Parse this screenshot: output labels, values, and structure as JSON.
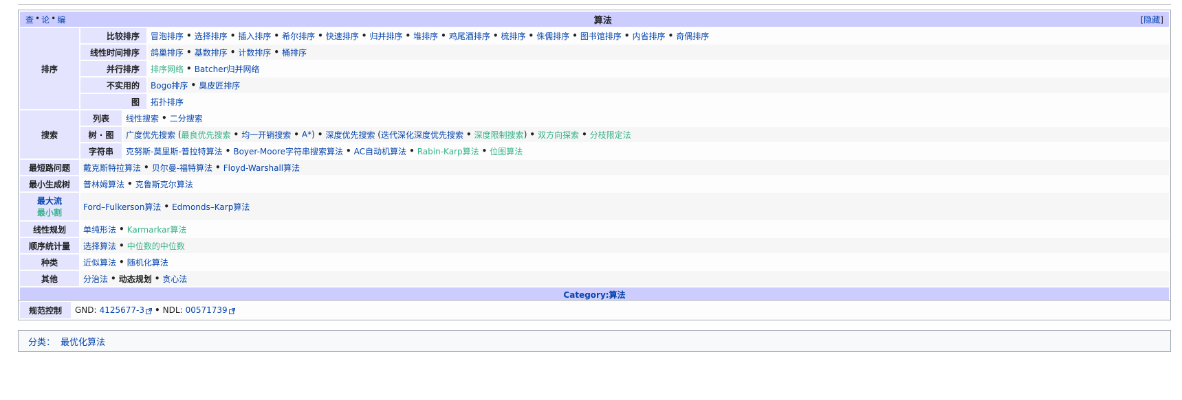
{
  "navbox": {
    "vte": [
      "查",
      "论",
      "编"
    ],
    "title": "算法",
    "hide_label": "隐藏",
    "below_label": "Category:算法"
  },
  "sorting": {
    "group": "排序",
    "rows": [
      {
        "label": "比较排序",
        "items": [
          "冒泡排序",
          "选择排序",
          "插入排序",
          "希尔排序",
          "快速排序",
          "归并排序",
          "堆排序",
          "鸡尾酒排序",
          "梳排序",
          "侏儒排序",
          "图书馆排序",
          "内省排序",
          "奇偶排序"
        ]
      },
      {
        "label": "线性时间排序",
        "items": [
          "鸽巢排序",
          "基数排序",
          "计数排序",
          "桶排序"
        ]
      },
      {
        "label": "并行排序",
        "items": [
          "排序网络",
          "Batcher归并网络"
        ]
      },
      {
        "label": "不实用的",
        "items": [
          "Bogo排序",
          "臭皮匠排序"
        ]
      },
      {
        "label": "图",
        "items": [
          "拓扑排序"
        ]
      }
    ]
  },
  "search": {
    "group": "搜索",
    "list_label": "列表",
    "list_items": [
      "线性搜索",
      "二分搜索"
    ],
    "tree_label": "树 · 图",
    "tree_bfs": "广度优先搜索",
    "tree_bfs_sub": [
      "最良优先搜索",
      "均一开销搜索",
      "A*"
    ],
    "tree_dfs": "深度优先搜索",
    "tree_dfs_sub": [
      "迭代深化深度优先搜索",
      "深度限制搜索"
    ],
    "tree_rest": [
      "双方向探索",
      "分枝限定法"
    ],
    "string_label": "字符串",
    "string_items": [
      "克努斯-莫里斯-普拉特算法",
      "Boyer-Moore字符串搜索算法",
      "AC自动机算法",
      "Rabin-Karp算法",
      "位图算法"
    ]
  },
  "shortest": {
    "label": "最短路问题",
    "items": [
      "戴克斯特拉算法",
      "贝尔曼-福特算法",
      "Floyd-Warshall算法"
    ]
  },
  "mst": {
    "label": "最小生成树",
    "items": [
      "普林姆算法",
      "克鲁斯克尔算法"
    ]
  },
  "maxflow": {
    "label1": "最大流",
    "label2": "最小割",
    "items": [
      "Ford–Fulkerson算法",
      "Edmonds–Karp算法"
    ]
  },
  "lp": {
    "label": "线性规划",
    "items": [
      "单纯形法",
      "Karmarkar算法"
    ]
  },
  "order": {
    "label": "顺序统计量",
    "items": [
      "选择算法",
      "中位数的中位数"
    ]
  },
  "kinds": {
    "label": "种类",
    "items": [
      "近似算法",
      "随机化算法"
    ]
  },
  "other": {
    "label": "其他",
    "items": [
      "分治法",
      "动态规划",
      "贪心法"
    ]
  },
  "authority": {
    "label": "规范控制",
    "gnd_prefix": "GND:",
    "gnd": "4125677-3",
    "ndl_prefix": "NDL:",
    "ndl": "00571739"
  },
  "categories": {
    "label": "分类：",
    "items": [
      "最优化算法"
    ]
  },
  "colors": {
    "header": "#ccccff",
    "group": "#e4e4ff",
    "link": "#0645ad",
    "redlink_green": "#36b28a"
  }
}
